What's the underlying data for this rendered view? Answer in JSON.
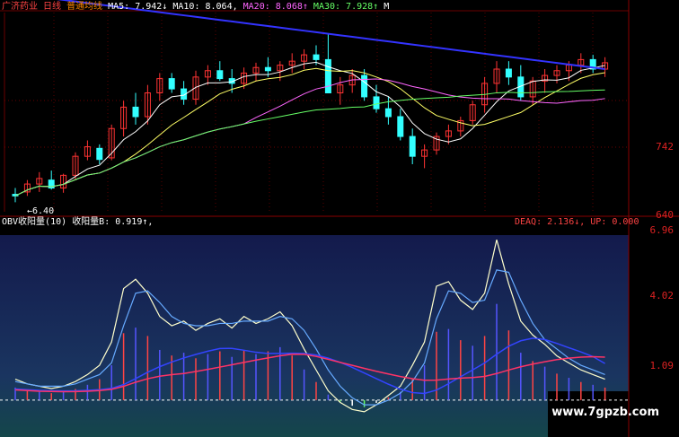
{
  "header": {
    "stock_name": "广济药业",
    "period": "日线",
    "indicator_name": "普通均线",
    "ma": [
      {
        "label": "MA5: 7.942↓",
        "color": "#ffffff"
      },
      {
        "label": "MA10: 8.064,",
        "color": "#ffffff"
      },
      {
        "label": "MA20: 8.068↑",
        "color": "#ff66ff"
      },
      {
        "label": "MA30: 7.928↑",
        "color": "#66ff66"
      },
      {
        "label": "M",
        "color": "#ffffff"
      }
    ]
  },
  "price_axis": {
    "labels": [
      "742",
      "640"
    ],
    "low_marker": "←6.40"
  },
  "sub_indicator": {
    "title": "OBV收阳量(10)",
    "value": "收阳量B: 0.919↑,",
    "right_value": "DEAQ: 2.136↓, UP: 0.000"
  },
  "sub_axis": {
    "labels": [
      "6.96",
      "4.02",
      "1.09"
    ]
  },
  "watermark": "www.7gpzb.com",
  "colors": {
    "price_up": "#ff3333",
    "price_down": "#33ffff",
    "ma5": "#ffffff",
    "ma10": "#ffff66",
    "ma20": "#ff66ff",
    "ma30": "#66ff66",
    "long_ma": "#3333ff"
  },
  "chart_data": [
    {
      "type": "candlestick",
      "title": "",
      "y_axis_labels": [
        6.4,
        7.42
      ],
      "candles_ohlc": [
        [
          6.42,
          6.5,
          6.32,
          6.4
        ],
        [
          6.45,
          6.6,
          6.4,
          6.55
        ],
        [
          6.55,
          6.7,
          6.45,
          6.62
        ],
        [
          6.6,
          6.72,
          6.48,
          6.5
        ],
        [
          6.5,
          6.68,
          6.44,
          6.66
        ],
        [
          6.66,
          6.95,
          6.6,
          6.9
        ],
        [
          6.9,
          7.1,
          6.85,
          7.02
        ],
        [
          7.0,
          7.05,
          6.8,
          6.86
        ],
        [
          6.88,
          7.3,
          6.85,
          7.25
        ],
        [
          7.25,
          7.6,
          7.15,
          7.52
        ],
        [
          7.52,
          7.7,
          7.3,
          7.4
        ],
        [
          7.4,
          7.8,
          7.3,
          7.7
        ],
        [
          7.7,
          7.95,
          7.6,
          7.88
        ],
        [
          7.88,
          7.95,
          7.7,
          7.75
        ],
        [
          7.75,
          7.85,
          7.55,
          7.62
        ],
        [
          7.62,
          7.98,
          7.55,
          7.9
        ],
        [
          7.9,
          8.05,
          7.8,
          7.98
        ],
        [
          7.98,
          8.1,
          7.85,
          7.88
        ],
        [
          7.88,
          8.0,
          7.7,
          7.82
        ],
        [
          7.82,
          8.02,
          7.75,
          7.95
        ],
        [
          7.95,
          8.08,
          7.85,
          8.02
        ],
        [
          8.02,
          8.15,
          7.9,
          7.98
        ],
        [
          7.98,
          8.1,
          7.85,
          8.05
        ],
        [
          8.05,
          8.2,
          7.95,
          8.1
        ],
        [
          8.1,
          8.25,
          8.0,
          8.18
        ],
        [
          8.18,
          8.3,
          8.05,
          8.12
        ],
        [
          8.12,
          8.45,
          8.05,
          7.7
        ],
        [
          7.7,
          7.9,
          7.55,
          7.8
        ],
        [
          7.8,
          8.0,
          7.7,
          7.92
        ],
        [
          7.92,
          8.0,
          7.6,
          7.65
        ],
        [
          7.65,
          7.8,
          7.45,
          7.5
        ],
        [
          7.5,
          7.65,
          7.3,
          7.4
        ],
        [
          7.4,
          7.5,
          7.1,
          7.15
        ],
        [
          7.15,
          7.25,
          6.8,
          6.9
        ],
        [
          6.9,
          7.05,
          6.75,
          6.98
        ],
        [
          6.98,
          7.2,
          6.92,
          7.15
        ],
        [
          7.15,
          7.3,
          7.05,
          7.22
        ],
        [
          7.22,
          7.4,
          7.15,
          7.35
        ],
        [
          7.35,
          7.6,
          7.3,
          7.55
        ],
        [
          7.55,
          7.9,
          7.45,
          7.82
        ],
        [
          7.82,
          8.1,
          7.7,
          8.0
        ],
        [
          8.0,
          8.1,
          7.8,
          7.9
        ],
        [
          7.9,
          8.05,
          7.6,
          7.65
        ],
        [
          7.65,
          7.9,
          7.55,
          7.85
        ],
        [
          7.85,
          8.0,
          7.7,
          7.92
        ],
        [
          7.92,
          8.05,
          7.82,
          7.98
        ],
        [
          7.98,
          8.1,
          7.85,
          8.05
        ],
        [
          8.05,
          8.2,
          7.95,
          8.12
        ],
        [
          8.12,
          8.18,
          7.95,
          8.0
        ],
        [
          8.0,
          8.15,
          7.9,
          8.08
        ]
      ]
    },
    {
      "type": "line",
      "title": "OBV收阳量(10)",
      "y_axis_labels": [
        1.09,
        4.02,
        6.96
      ],
      "series": [
        {
          "name": "收阳量B",
          "values": [
            0.9,
            0.7,
            0.6,
            0.5,
            0.6,
            0.8,
            1.1,
            1.5,
            2.5,
            4.8,
            5.2,
            4.6,
            3.6,
            3.2,
            3.4,
            3.0,
            3.3,
            3.5,
            3.1,
            3.6,
            3.3,
            3.5,
            3.8,
            3.2,
            2.2,
            1.3,
            0.4,
            -0.1,
            -0.4,
            -0.5,
            -0.2,
            0.2,
            0.6,
            1.5,
            2.5,
            4.9,
            5.1,
            4.3,
            3.9,
            4.6,
            6.9,
            5.0,
            3.4,
            2.8,
            2.4,
            1.9,
            1.6,
            1.3,
            1.1,
            0.9
          ]
        },
        {
          "name": "DEAQ",
          "values": [
            0.8,
            0.7,
            0.6,
            0.6,
            0.6,
            0.7,
            0.9,
            1.1,
            1.6,
            3.2,
            4.6,
            4.7,
            4.2,
            3.6,
            3.3,
            3.2,
            3.2,
            3.3,
            3.3,
            3.4,
            3.4,
            3.4,
            3.6,
            3.5,
            3.0,
            2.2,
            1.3,
            0.6,
            0.1,
            -0.2,
            -0.2,
            0.0,
            0.3,
            0.8,
            1.6,
            3.5,
            4.7,
            4.6,
            4.2,
            4.3,
            5.6,
            5.5,
            4.3,
            3.3,
            2.6,
            2.2,
            1.8,
            1.5,
            1.3,
            1.1
          ]
        }
      ]
    }
  ]
}
